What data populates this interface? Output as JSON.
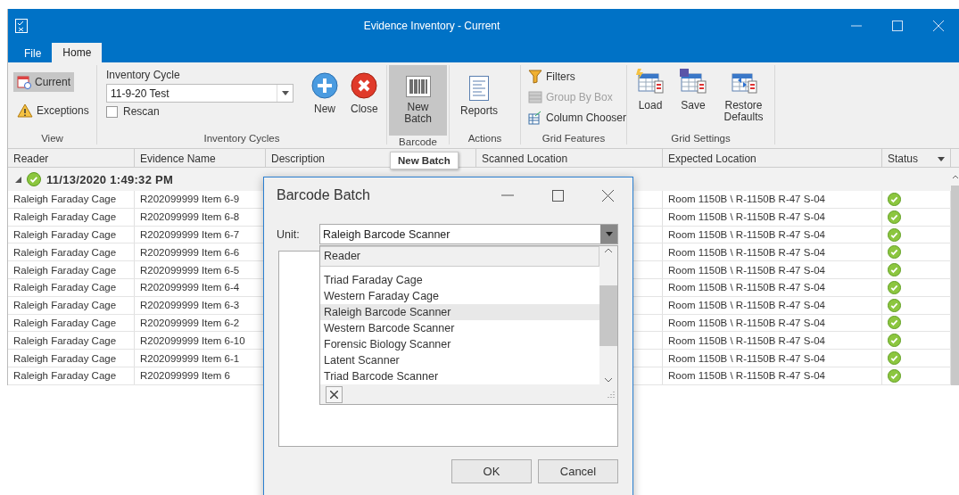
{
  "window": {
    "title": "Evidence Inventory - Current"
  },
  "tabs": [
    {
      "label": "File",
      "selected": false
    },
    {
      "label": "Home",
      "selected": true
    }
  ],
  "ribbon": {
    "view": {
      "label": "View",
      "buttons": [
        {
          "label": "Current",
          "selected": true
        },
        {
          "label": "Exceptions",
          "selected": false
        }
      ]
    },
    "inventory_cycles": {
      "label": "Inventory Cycles",
      "field_label": "Inventory Cycle",
      "value": "11-9-20 Test",
      "rescan": {
        "label": "Rescan",
        "checked": false
      },
      "new": "New",
      "close": "Close"
    },
    "barcode": {
      "label": "Barcode",
      "new_batch": {
        "label": "New Batch",
        "pressed": true
      }
    },
    "actions": {
      "label": "Actions",
      "reports": "Reports"
    },
    "grid_features": {
      "label": "Grid Features",
      "items": [
        {
          "label": "Filters",
          "disabled": false
        },
        {
          "label": "Group By Box",
          "disabled": true
        },
        {
          "label": "Column Chooser",
          "disabled": false
        }
      ]
    },
    "grid_settings": {
      "label": "Grid Settings",
      "load": "Load",
      "save": "Save",
      "restore_defaults": "Restore Defaults"
    }
  },
  "tooltip": "New Batch",
  "grid": {
    "columns": [
      "Reader",
      "Evidence Name",
      "Description",
      "Scanned Location",
      "Expected Location",
      "Status"
    ],
    "group": {
      "label": "11/13/2020 1:49:32 PM",
      "expanded": true
    },
    "rows": [
      {
        "reader": "Raleigh Faraday Cage",
        "evidence_name": "R202099999 Item 6-9",
        "expected_location": "Room 1150B \\ R-1150B R-47 S-04",
        "verified": true
      },
      {
        "reader": "Raleigh Faraday Cage",
        "evidence_name": "R202099999 Item 6-8",
        "expected_location": "Room 1150B \\ R-1150B R-47 S-04",
        "verified": true
      },
      {
        "reader": "Raleigh Faraday Cage",
        "evidence_name": "R202099999 Item 6-7",
        "expected_location": "Room 1150B \\ R-1150B R-47 S-04",
        "verified": true
      },
      {
        "reader": "Raleigh Faraday Cage",
        "evidence_name": "R202099999 Item 6-6",
        "expected_location": "Room 1150B \\ R-1150B R-47 S-04",
        "verified": true
      },
      {
        "reader": "Raleigh Faraday Cage",
        "evidence_name": "R202099999 Item 6-5",
        "expected_location": "Room 1150B \\ R-1150B R-47 S-04",
        "verified": true
      },
      {
        "reader": "Raleigh Faraday Cage",
        "evidence_name": "R202099999 Item 6-4",
        "expected_location": "Room 1150B \\ R-1150B R-47 S-04",
        "verified": true
      },
      {
        "reader": "Raleigh Faraday Cage",
        "evidence_name": "R202099999 Item 6-3",
        "expected_location": "Room 1150B \\ R-1150B R-47 S-04",
        "verified": true
      },
      {
        "reader": "Raleigh Faraday Cage",
        "evidence_name": "R202099999 Item 6-2",
        "expected_location": "Room 1150B \\ R-1150B R-47 S-04",
        "verified": true
      },
      {
        "reader": "Raleigh Faraday Cage",
        "evidence_name": "R202099999 Item 6-10",
        "expected_location": "Room 1150B \\ R-1150B R-47 S-04",
        "verified": true
      },
      {
        "reader": "Raleigh Faraday Cage",
        "evidence_name": "R202099999 Item 6-1",
        "expected_location": "Room 1150B \\ R-1150B R-47 S-04",
        "verified": true
      },
      {
        "reader": "Raleigh Faraday Cage",
        "evidence_name": "R202099999 Item 6",
        "expected_location": "Room 1150B \\ R-1150B R-47 S-04",
        "verified": true
      }
    ]
  },
  "dialog": {
    "title": "Barcode Batch",
    "unit_label": "Unit:",
    "unit_value": "Raleigh Barcode Scanner",
    "dropdown": {
      "header": "Reader",
      "items": [
        {
          "label": "Triad Faraday Cage",
          "selected": false
        },
        {
          "label": "Western Faraday Cage",
          "selected": false
        },
        {
          "label": "Raleigh Barcode Scanner",
          "selected": true
        },
        {
          "label": "Western Barcode Scanner",
          "selected": false
        },
        {
          "label": "Forensic Biology Scanner",
          "selected": false
        },
        {
          "label": "Latent Scanner",
          "selected": false
        },
        {
          "label": "Triad Barcode Scanner",
          "selected": false
        }
      ]
    },
    "buttons": [
      "OK",
      "Cancel"
    ]
  }
}
